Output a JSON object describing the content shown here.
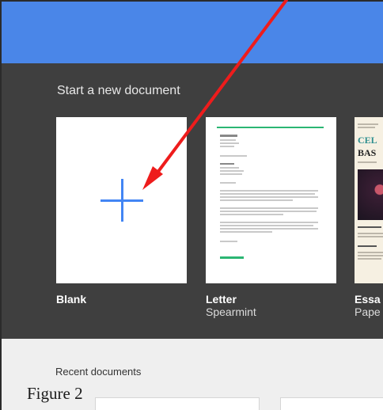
{
  "gallery": {
    "title": "Start a new document",
    "templates": [
      {
        "name": "Blank",
        "subtitle": ""
      },
      {
        "name": "Letter",
        "subtitle": "Spearmint"
      },
      {
        "name": "Essa",
        "subtitle": "Pape"
      }
    ],
    "essay_preview": {
      "heading_1": "CEL",
      "heading_2": "BAS"
    }
  },
  "recent": {
    "title": "Recent documents"
  },
  "caption": "Figure 2",
  "colors": {
    "topbar": "#4a86e8",
    "gallery_bg": "#3f3f3f",
    "plus": "#4285f4",
    "accent_green": "#2bb673",
    "arrow": "#ee1c1c"
  },
  "icons": {
    "blank_template": "plus-icon",
    "annotation": "red-arrow"
  }
}
